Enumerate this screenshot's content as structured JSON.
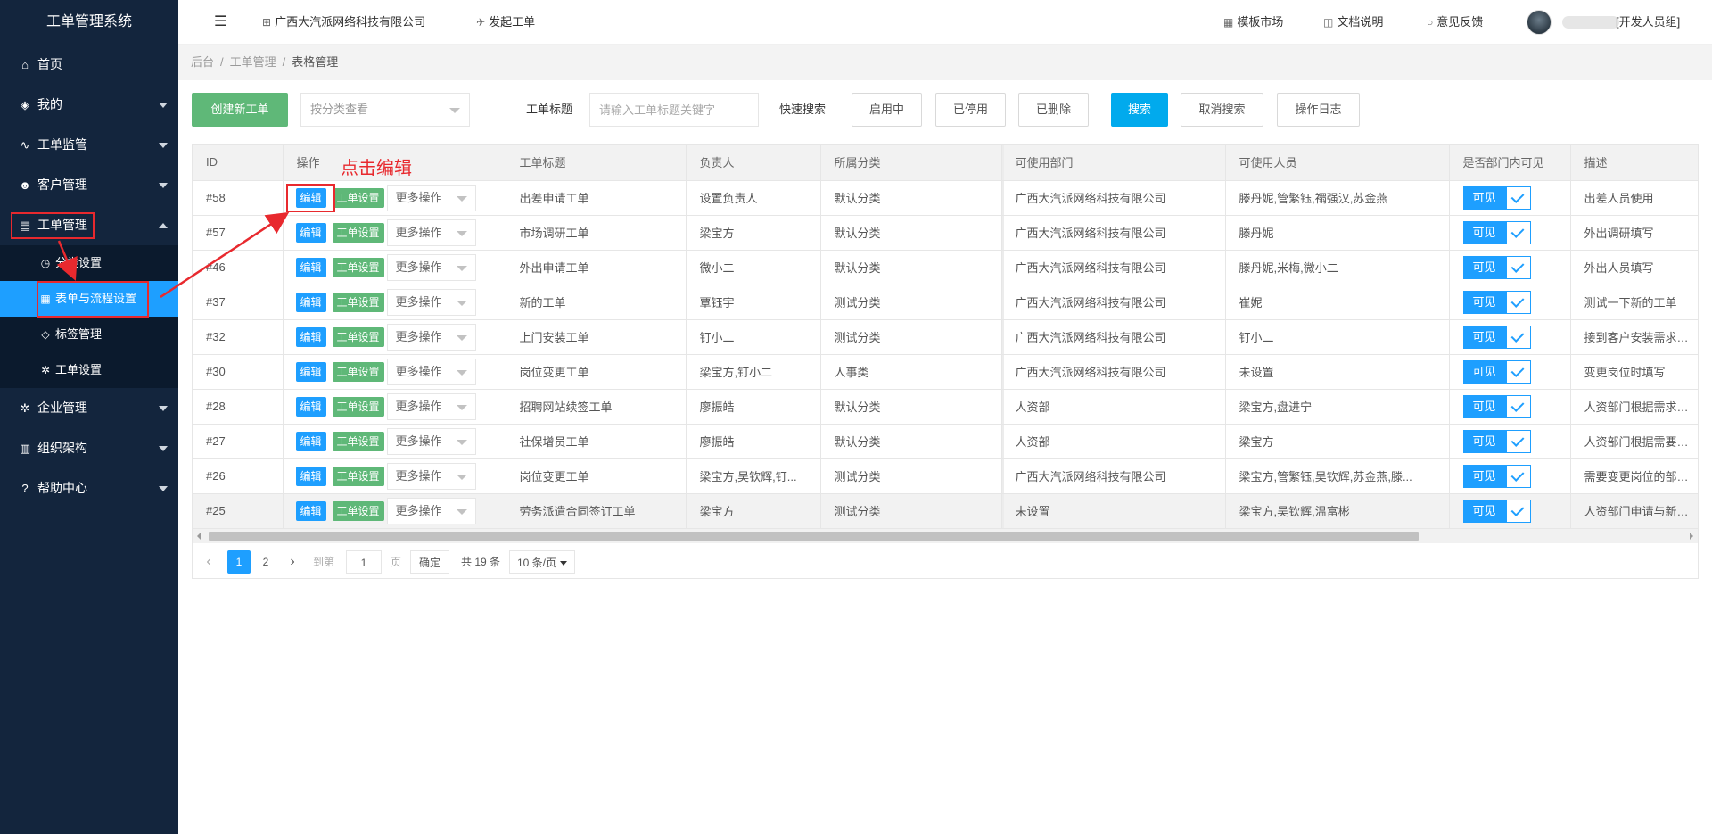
{
  "app": {
    "title": "工单管理系统"
  },
  "sidebar": {
    "items": [
      {
        "label": "首页"
      },
      {
        "label": "我的"
      },
      {
        "label": "工单监管"
      },
      {
        "label": "客户管理"
      },
      {
        "label": "工单管理"
      },
      {
        "label": "企业管理"
      },
      {
        "label": "组织架构"
      },
      {
        "label": "帮助中心"
      }
    ],
    "sub_items": [
      {
        "label": "分类设置"
      },
      {
        "label": "表单与流程设置"
      },
      {
        "label": "标签管理"
      },
      {
        "label": "工单设置"
      }
    ]
  },
  "header": {
    "company": "广西大汽派网络科技有限公司",
    "create": "发起工单",
    "templates": "模板市场",
    "docs": "文档说明",
    "feedback": "意见反馈",
    "user_suffix": "[开发人员组]"
  },
  "breadcrumb": [
    "后台",
    "工单管理",
    "表格管理"
  ],
  "toolbar": {
    "create_button": "创建新工单",
    "category_select_placeholder": "按分类查看",
    "title_label": "工单标题",
    "title_placeholder": "请输入工单标题关键字",
    "quick_label": "快速搜索",
    "quick_filters": [
      "启用中",
      "已停用",
      "已删除"
    ],
    "search": "搜索",
    "cancel_search": "取消搜索",
    "log": "操作日志"
  },
  "table": {
    "columns": [
      "ID",
      "操作",
      "工单标题",
      "负责人",
      "所属分类",
      "可使用部门",
      "可使用人员",
      "是否部门内可见",
      "描述"
    ],
    "edit_label": "编辑",
    "settings_label": "工单设置",
    "more_label": "更多操作",
    "visible_label": "可见",
    "rows": [
      {
        "id": "#58",
        "title": "出差申请工单",
        "owner": "设置负责人",
        "category": "默认分类",
        "dept": "广西大汽派网络科技有限公司",
        "users": "滕丹妮,管繁钰,禤强汉,苏金燕",
        "desc": "出差人员使用"
      },
      {
        "id": "#57",
        "title": "市场调研工单",
        "owner": "梁宝方",
        "category": "默认分类",
        "dept": "广西大汽派网络科技有限公司",
        "users": "滕丹妮",
        "desc": "外出调研填写"
      },
      {
        "id": "#46",
        "title": "外出申请工单",
        "owner": "微小二",
        "category": "默认分类",
        "dept": "广西大汽派网络科技有限公司",
        "users": "滕丹妮,米梅,微小二",
        "desc": "外出人员填写"
      },
      {
        "id": "#37",
        "title": "新的工单",
        "owner": "覃钰宇",
        "category": "测试分类",
        "dept": "广西大汽派网络科技有限公司",
        "users": "崔妮",
        "desc": "测试一下新的工单"
      },
      {
        "id": "#32",
        "title": "上门安装工单",
        "owner": "钉小二",
        "category": "测试分类",
        "dept": "广西大汽派网络科技有限公司",
        "users": "钉小二",
        "desc": "接到客户安装需求后,..."
      },
      {
        "id": "#30",
        "title": "岗位变更工单",
        "owner": "梁宝方,钉小二",
        "category": "人事类",
        "dept": "广西大汽派网络科技有限公司",
        "users": "未设置",
        "desc": "变更岗位时填写"
      },
      {
        "id": "#28",
        "title": "招聘网站续签工单",
        "owner": "廖振皓",
        "category": "默认分类",
        "dept": "人资部",
        "users": "梁宝方,盘进宁",
        "desc": "人资部门根据需求发起..."
      },
      {
        "id": "#27",
        "title": "社保增员工单",
        "owner": "廖振皓",
        "category": "默认分类",
        "dept": "人资部",
        "users": "梁宝方",
        "desc": "人资部门根据需要增员..."
      },
      {
        "id": "#26",
        "title": "岗位变更工单",
        "owner": "梁宝方,吴钦辉,钉...",
        "category": "测试分类",
        "dept": "广西大汽派网络科技有限公司",
        "users": "梁宝方,管繁钰,吴钦辉,苏金燕,滕...",
        "desc": "需要变更岗位的部门发..."
      },
      {
        "id": "#25",
        "title": "劳务派遣合同签订工单",
        "owner": "梁宝方",
        "category": "测试分类",
        "dept": "未设置",
        "users": "梁宝方,吴钦辉,温富彬",
        "desc": "人资部门申请与新员工..."
      }
    ]
  },
  "pagination": {
    "pages": [
      "1",
      "2"
    ],
    "goto_label": "到第",
    "goto_value": "1",
    "page_unit": "页",
    "confirm": "确定",
    "total": "共 19 条",
    "page_size": "10 条/页"
  },
  "annotation": {
    "text": "点击编辑",
    "color": "#e8292e"
  }
}
